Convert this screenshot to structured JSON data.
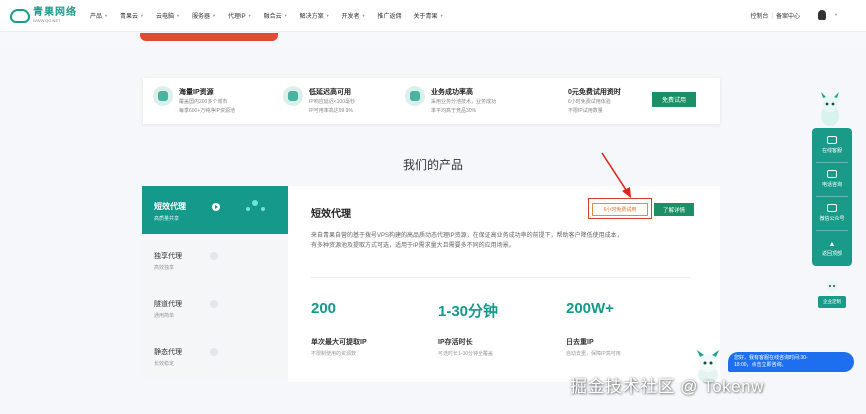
{
  "header": {
    "logo": {
      "name": "青果网络",
      "url": "WWW.QG.NET"
    },
    "nav": [
      {
        "label": "产品",
        "caret": true
      },
      {
        "label": "青果云",
        "caret": true
      },
      {
        "label": "云电脑",
        "caret": true
      },
      {
        "label": "服务器",
        "caret": true
      },
      {
        "label": "代理IP",
        "caret": true
      },
      {
        "label": "融合云",
        "caret": true
      },
      {
        "label": "解决方案",
        "caret": true
      },
      {
        "label": "开发者",
        "caret": true
      },
      {
        "label": "推广返佣",
        "caret": false
      },
      {
        "label": "关于青果",
        "caret": true
      }
    ],
    "right": {
      "console": "控制台",
      "separator": "|",
      "account": "备案中心"
    }
  },
  "features": [
    {
      "title": "海量IP资源",
      "desc1": "覆盖国内200多个城市",
      "desc2": "每季600+万纯净IP资源池"
    },
    {
      "title": "低延迟高可用",
      "desc1": "IP响应延迟<100毫秒",
      "desc2": "IP可用率高达99.9%"
    },
    {
      "title": "业务成功率高",
      "desc1": "采用业务分池技术，业务成功",
      "desc2": "率平均高于竞品30%"
    },
    {
      "title": "0元免费试用资时",
      "desc1": "6小时免费试用体验",
      "desc2": "不限IP试用数量"
    }
  ],
  "trial_button": "免费试用",
  "section_title": "我们的产品",
  "products": {
    "tabs": [
      {
        "name": "短效代理",
        "sub": "高质量共享"
      },
      {
        "name": "独享代理",
        "sub": "高效独享"
      },
      {
        "name": "隧道代理",
        "sub": "通用简单"
      },
      {
        "name": "静态代理",
        "sub": "长效稳定"
      }
    ],
    "detail": {
      "title": "短效代理",
      "free_trial": "6小时免费试用",
      "learn_more": "了解详情",
      "desc_line1": "来自青果自营的基于拨号VPS构建的高品质动态代理IP资源，在保证高业务成功率的前提下，帮助客户降低使用成本，",
      "desc_line2": "有多种资源池及提取方式可选，适用于IP需求量大且需要多不同的应用场景。",
      "stats": [
        {
          "value": "200",
          "label": "单次最大可提取IP",
          "sub": "不限制使用的资源数"
        },
        {
          "value": "1-30分钟",
          "label": "IP存活时长",
          "sub": "可选时长1-30分钟全覆盖"
        },
        {
          "value": "200W+",
          "label": "日去重IP",
          "sub": "自动去重，保障IP高可用"
        }
      ]
    }
  },
  "sidebar": {
    "items": [
      {
        "label": "在线客服"
      },
      {
        "label": "电话咨询"
      },
      {
        "label": "微信公众号"
      },
      {
        "label": "返回顶部"
      }
    ],
    "custom": "企业定制"
  },
  "chat": {
    "line1": "您好，我有客服在线咨询时间:30-",
    "line2": "18:00，点击立即咨询。"
  },
  "watermark": "掘金技术社区 @ Tokenw"
}
